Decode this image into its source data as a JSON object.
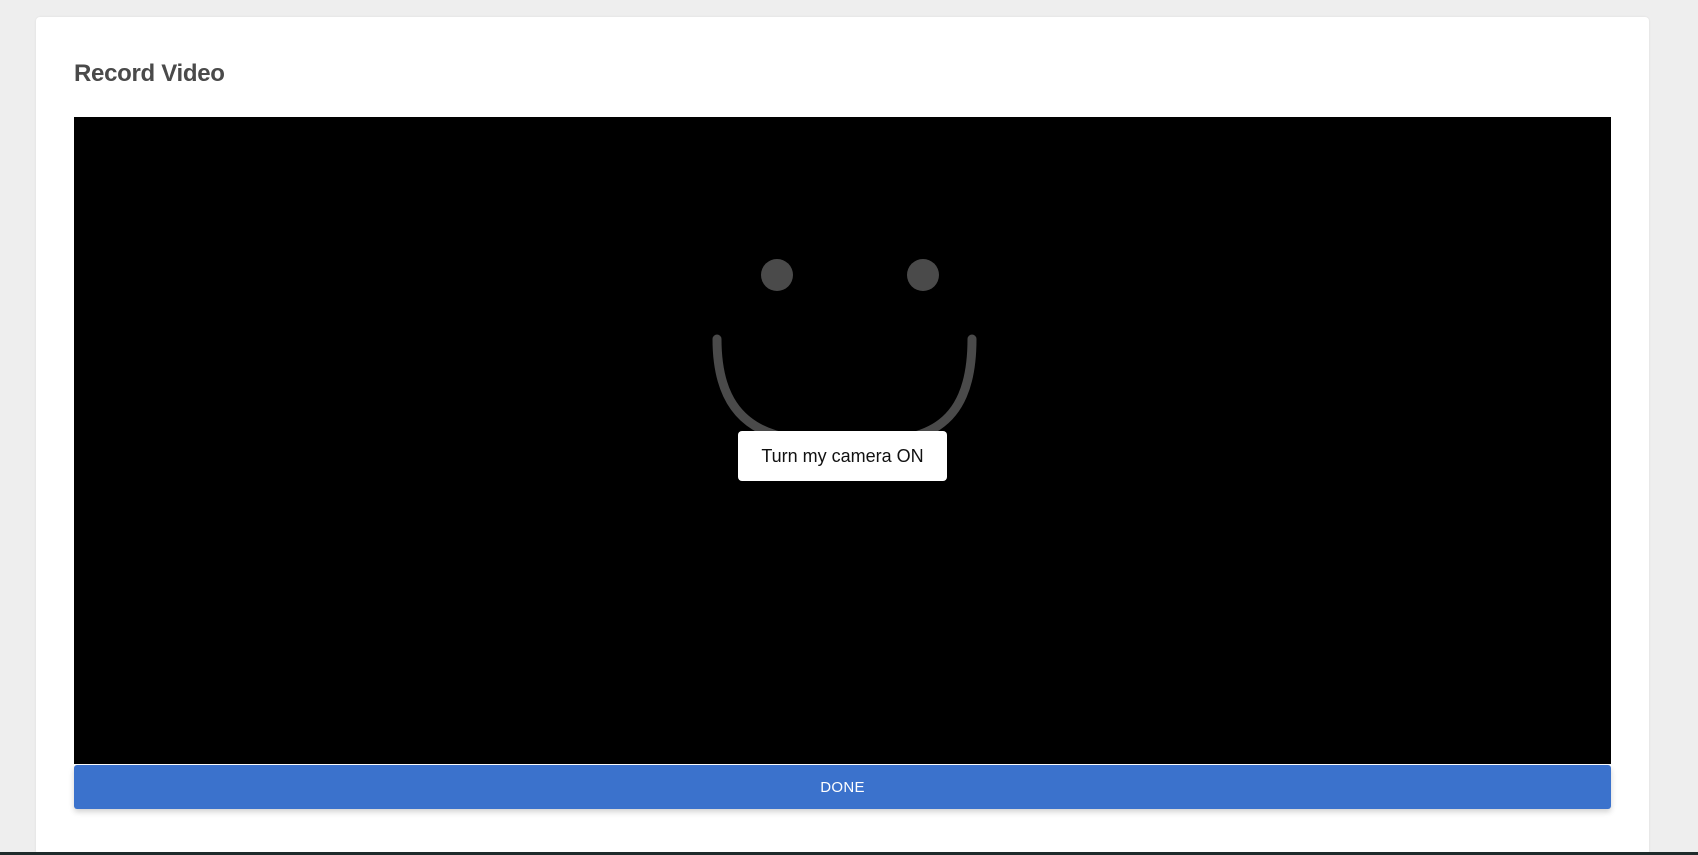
{
  "page": {
    "title": "Record Video"
  },
  "video": {
    "camera_button_label": "Turn my camera ON",
    "placeholder_icon": "smiley-face-icon",
    "background_color": "#000000",
    "icon_color": "#4a4a4a"
  },
  "actions": {
    "done_label": "DONE",
    "done_color": "#3b72cc"
  }
}
